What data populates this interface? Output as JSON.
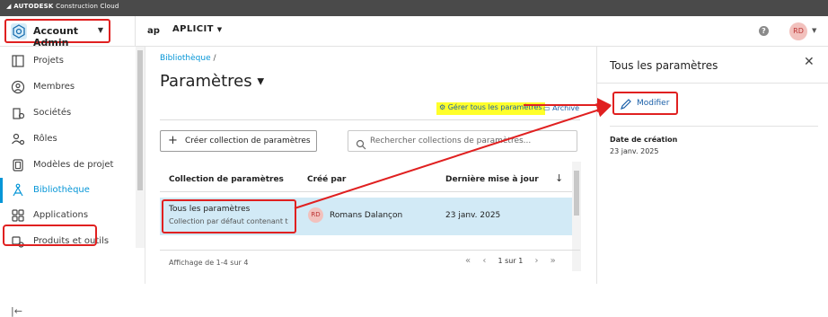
{
  "topbar": {
    "brand": "AUTODESK",
    "product": "Construction Cloud"
  },
  "header": {
    "account_label": "Account Admin",
    "project_name": "APLICIT",
    "avatar_initials": "RD",
    "help_glyph": "?"
  },
  "sidebar": {
    "items": [
      {
        "label": "Projets",
        "icon": "projects-icon"
      },
      {
        "label": "Membres",
        "icon": "members-icon"
      },
      {
        "label": "Sociétés",
        "icon": "companies-icon"
      },
      {
        "label": "Rôles",
        "icon": "roles-icon"
      },
      {
        "label": "Modèles de projet",
        "icon": "project-templates-icon"
      },
      {
        "label": "Bibliothèque",
        "icon": "library-icon",
        "active": true
      },
      {
        "label": "Applications",
        "icon": "applications-icon"
      },
      {
        "label": "Produits et outils",
        "icon": "products-tools-icon"
      }
    ],
    "collapse_glyph": "|←"
  },
  "main": {
    "breadcrumb": "Bibliothèque",
    "breadcrumb_sep": "/",
    "title": "Paramètres",
    "manage_all": "Gérer tous les paramètres",
    "archive": "Archivé",
    "create_button": "Créer collection de paramètres",
    "search_placeholder": "Rechercher collections de paramètres...",
    "table": {
      "columns": [
        "Collection de paramètres",
        "Créé par",
        "Dernière mise à jour"
      ],
      "rows": [
        {
          "name": "Tous les paramètres",
          "description": "Collection par défaut contenant t",
          "author_initials": "RD",
          "author": "Romans Dalançon",
          "updated": "23 janv. 2025"
        }
      ]
    },
    "footer": {
      "count": "Affichage de 1-4 sur 4",
      "page": "1 sur 1"
    }
  },
  "panel": {
    "title": "Tous les paramètres",
    "modify_button": "Modifier",
    "created_label": "Date de création",
    "created_value": "23 janv. 2025"
  },
  "colors": {
    "accent": "#0696d7",
    "highlight_red": "#e02020",
    "selected_row": "#d2eaf6",
    "marker_yellow": "#ffff2a",
    "topbar": "#4a4a4a"
  }
}
